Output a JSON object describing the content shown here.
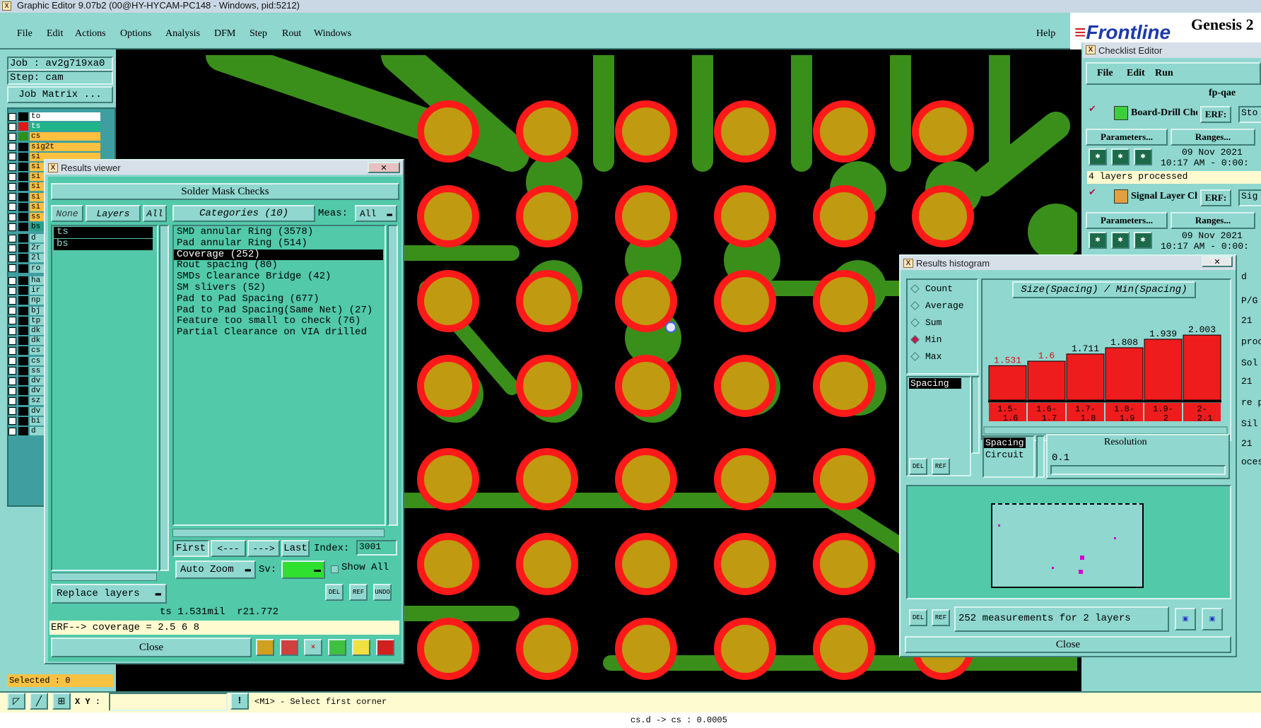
{
  "window": {
    "title": "Graphic Editor 9.07b2 (00@HY-HYCAM-PC148 - Windows, pid:5212)"
  },
  "menubar": {
    "items": [
      "File",
      "Edit",
      "Actions",
      "Options",
      "Analysis",
      "DFM",
      "Step",
      "Rout",
      "Windows"
    ],
    "help": "Help"
  },
  "brand": {
    "logo": "Frontline",
    "product": "Genesis 2"
  },
  "job": {
    "job_label": "Job : av2g719xa0",
    "step_label": "Step: cam",
    "matrix_button": "Job Matrix ..."
  },
  "layers": [
    {
      "name": "to",
      "color": "#ffffff"
    },
    {
      "name": "ts",
      "color": "#1fb48a",
      "swatch": "#e01818"
    },
    {
      "name": "cs",
      "color": "#ffc040",
      "swatch": "#2f8f1f"
    },
    {
      "name": "sig2t",
      "color": "#ffc040"
    },
    {
      "name": "si",
      "color": "#ffc040"
    },
    {
      "name": "si",
      "color": "#ffc040"
    },
    {
      "name": "si",
      "color": "#ffc040"
    },
    {
      "name": "si",
      "color": "#ffc040"
    },
    {
      "name": "si",
      "color": "#ffc040"
    },
    {
      "name": "si",
      "color": "#ffc040"
    },
    {
      "name": "ss",
      "color": "#ffc040"
    },
    {
      "name": "bs",
      "color": "#2aa08a"
    }
  ],
  "layers2": [
    "d",
    "2r",
    "2l",
    "ro"
  ],
  "layers3": [
    "ha",
    "ir",
    "np",
    "bj",
    "tp",
    "dk",
    "dk",
    "cs",
    "cs",
    "ss",
    "dv",
    "dv",
    "sz",
    "dv",
    "bi",
    "d"
  ],
  "status": {
    "selected": "Selected : 0",
    "xy_label": "X Y :",
    "prompt": "<M1> - Select first corner",
    "bottom": "cs.d -> cs : 0.0005"
  },
  "results_viewer": {
    "title": "Results viewer",
    "header": "Solder Mask Checks",
    "none_btn": "None",
    "layers_btn": "Layers",
    "all_btn": "All",
    "categories_btn": "Categories (10)",
    "meas_label": "Meas:",
    "meas_value": "All",
    "layers_list": [
      "ts",
      "bs"
    ],
    "categories": [
      "SMD annular Ring (3578)",
      "Pad annular Ring (514)",
      "Coverage (252)",
      "Rout spacing (80)",
      "SMDs Clearance Bridge (42)",
      "SM slivers (52)",
      "Pad to Pad Spacing (677)",
      "Pad to Pad Spacing(Same Net) (27)",
      "Feature too small to check (76)",
      "Partial Clearance on VIA drilled"
    ],
    "selected_index": 2,
    "nav": {
      "first": "First",
      "prev": "<---",
      "next": "--->",
      "last": "Last",
      "index_label": "Index:",
      "index_value": "3001"
    },
    "auto_zoom": "Auto Zoom",
    "sv_label": "Sv:",
    "show_all": "Show All",
    "replace_layers": "Replace layers",
    "del": "DEL",
    "ref": "REF",
    "undo": "UNDO",
    "info": "ts 1.531mil  r21.772",
    "erf": "ERF--> coverage = 2.5 6 8",
    "close": "Close"
  },
  "checklist": {
    "title": "Checklist Editor",
    "menu": [
      "File",
      "Edit",
      "Run"
    ],
    "name": "fp-qae",
    "rows": [
      {
        "label": "Board-Drill Che",
        "erf": "ERF:",
        "date": "09 Nov 2021",
        "time": "10:17 AM - 0:00:",
        "params": "Parameters...",
        "ranges": "Ranges...",
        "status": "4 layers processed",
        "cut": "Sto"
      },
      {
        "label": "Signal Layer Ch",
        "erf": "ERF:",
        "date": "09 Nov 2021",
        "time": "10:17 AM - 0:00:",
        "params": "Parameters...",
        "ranges": "Ranges...",
        "cut": "Sig"
      }
    ],
    "edge": [
      "d",
      "P/G",
      "21",
      "proc",
      "Sol",
      "21",
      "re p",
      "Sil",
      "21",
      "oces"
    ]
  },
  "histogram": {
    "title": "Results histogram",
    "modes": [
      "Count",
      "Average",
      "Sum",
      "Min",
      "Max"
    ],
    "selected_mode": "Min",
    "heading": "Size(Spacing) / Min(Spacing)",
    "measure_list": [
      "Spacing"
    ],
    "sel_list": [
      "Spacing",
      "Circuit"
    ],
    "resolution_label": "Resolution",
    "resolution_value": "0.1",
    "summary": "252 measurements for 2 layers",
    "close": "Close",
    "del": "DEL",
    "ref": "REF"
  },
  "chart_data": {
    "type": "bar",
    "title": "Size(Spacing) / Min(Spacing)",
    "categories": [
      "1.5-1.6",
      "1.6-1.7",
      "1.7-1.8",
      "1.8-1.9",
      "1.9-2",
      "2-2.1"
    ],
    "values": [
      1.531,
      1.6,
      1.711,
      1.808,
      1.939,
      2.003
    ],
    "labels": [
      "1.531",
      "1.6",
      "1.711",
      "1.808",
      "1.939",
      "2.003"
    ],
    "bar_color": "#ee1c1c",
    "ylim": [
      0,
      2.2
    ]
  }
}
